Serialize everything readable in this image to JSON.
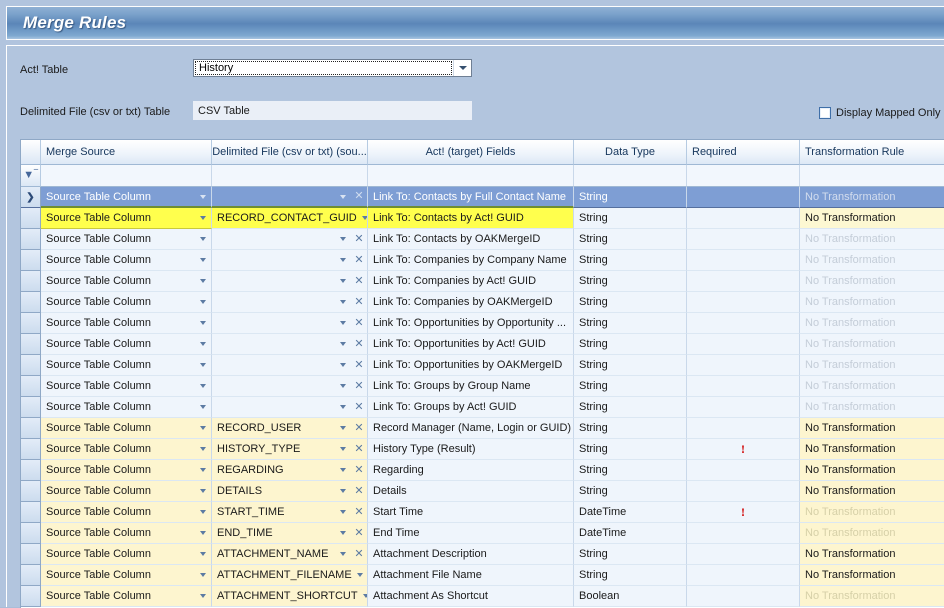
{
  "window": {
    "title": "Merge Rules"
  },
  "form": {
    "act_table_label": "Act! Table",
    "act_table_value": "History",
    "delim_table_label": "Delimited File (csv or txt) Table",
    "delim_table_value": "CSV Table",
    "mapped_only_label": "Display Mapped Only",
    "mapped_only_checked": false
  },
  "grid": {
    "columns": [
      "Merge Source",
      "Delimited File (csv or txt) (sou...",
      "Act! (target) Fields",
      "Data Type",
      "Required",
      "Transformation Rule"
    ],
    "filter_icon": "filter-icon",
    "rows": [
      {
        "source": "Source Table Column",
        "delimited": "",
        "act_field": "Link To: Contacts by Full Contact Name",
        "data_type": "String",
        "required": "",
        "transformation": "No Transformation",
        "state": "selected",
        "transform_active": false
      },
      {
        "source": "Source Table Column",
        "delimited": "RECORD_CONTACT_GUID",
        "act_field": "Link To: Contacts by Act! GUID",
        "data_type": "String",
        "required": "",
        "transformation": "No Transformation",
        "state": "active",
        "transform_active": true
      },
      {
        "source": "Source Table Column",
        "delimited": "",
        "act_field": "Link To: Contacts by OAKMergeID",
        "data_type": "String",
        "required": "",
        "transformation": "No Transformation",
        "state": "normal",
        "transform_active": false
      },
      {
        "source": "Source Table Column",
        "delimited": "",
        "act_field": "Link To: Companies by Company Name",
        "data_type": "String",
        "required": "",
        "transformation": "No Transformation",
        "state": "normal",
        "transform_active": false
      },
      {
        "source": "Source Table Column",
        "delimited": "",
        "act_field": "Link To: Companies by Act! GUID",
        "data_type": "String",
        "required": "",
        "transformation": "No Transformation",
        "state": "normal",
        "transform_active": false
      },
      {
        "source": "Source Table Column",
        "delimited": "",
        "act_field": "Link To: Companies by OAKMergeID",
        "data_type": "String",
        "required": "",
        "transformation": "No Transformation",
        "state": "normal",
        "transform_active": false
      },
      {
        "source": "Source Table Column",
        "delimited": "",
        "act_field": "Link To: Opportunities by Opportunity ...",
        "data_type": "String",
        "required": "",
        "transformation": "No Transformation",
        "state": "normal",
        "transform_active": false
      },
      {
        "source": "Source Table Column",
        "delimited": "",
        "act_field": "Link To: Opportunities by Act! GUID",
        "data_type": "String",
        "required": "",
        "transformation": "No Transformation",
        "state": "normal",
        "transform_active": false
      },
      {
        "source": "Source Table Column",
        "delimited": "",
        "act_field": "Link To: Opportunities by OAKMergeID",
        "data_type": "String",
        "required": "",
        "transformation": "No Transformation",
        "state": "normal",
        "transform_active": false
      },
      {
        "source": "Source Table Column",
        "delimited": "",
        "act_field": "Link To: Groups by Group Name",
        "data_type": "String",
        "required": "",
        "transformation": "No Transformation",
        "state": "normal",
        "transform_active": false
      },
      {
        "source": "Source Table Column",
        "delimited": "",
        "act_field": "Link To: Groups by Act! GUID",
        "data_type": "String",
        "required": "",
        "transformation": "No Transformation",
        "state": "normal",
        "transform_active": false
      },
      {
        "source": "Source Table Column",
        "delimited": "RECORD_USER",
        "act_field": "Record Manager (Name, Login or GUID)",
        "data_type": "String",
        "required": "",
        "transformation": "No Transformation",
        "state": "mapped",
        "transform_active": true
      },
      {
        "source": "Source Table Column",
        "delimited": "HISTORY_TYPE",
        "act_field": "History Type (Result)",
        "data_type": "String",
        "required": "required-marker",
        "transformation": "No Transformation",
        "state": "mapped",
        "transform_active": true
      },
      {
        "source": "Source Table Column",
        "delimited": "REGARDING",
        "act_field": "Regarding",
        "data_type": "String",
        "required": "",
        "transformation": "No Transformation",
        "state": "mapped",
        "transform_active": true
      },
      {
        "source": "Source Table Column",
        "delimited": "DETAILS",
        "act_field": "Details",
        "data_type": "String",
        "required": "",
        "transformation": "No Transformation",
        "state": "mapped",
        "transform_active": true
      },
      {
        "source": "Source Table Column",
        "delimited": "START_TIME",
        "act_field": "Start Time",
        "data_type": "DateTime",
        "required": "required-marker",
        "transformation": "No Transformation",
        "state": "mapped",
        "transform_active": false
      },
      {
        "source": "Source Table Column",
        "delimited": "END_TIME",
        "act_field": "End Time",
        "data_type": "DateTime",
        "required": "",
        "transformation": "No Transformation",
        "state": "mapped",
        "transform_active": false
      },
      {
        "source": "Source Table Column",
        "delimited": "ATTACHMENT_NAME",
        "act_field": "Attachment Description",
        "data_type": "String",
        "required": "",
        "transformation": "No Transformation",
        "state": "mapped",
        "transform_active": true
      },
      {
        "source": "Source Table Column",
        "delimited": "ATTACHMENT_FILENAME",
        "act_field": "Attachment File Name",
        "data_type": "String",
        "required": "",
        "transformation": "No Transformation",
        "state": "mapped",
        "transform_active": true
      },
      {
        "source": "Source Table Column",
        "delimited": "ATTACHMENT_SHORTCUT",
        "act_field": "Attachment As Shortcut",
        "data_type": "Boolean",
        "required": "",
        "transformation": "No Transformation",
        "state": "mapped",
        "transform_active": false
      }
    ]
  },
  "colors": {
    "title_accent": "#5b86b8",
    "panel": "#b2c5de",
    "row_base": "#eff5fc",
    "row_selected": "#7e9ed4",
    "row_active": "#ffff4d",
    "row_mapped": "#fdf5cf",
    "required_marker": "#d00000"
  }
}
